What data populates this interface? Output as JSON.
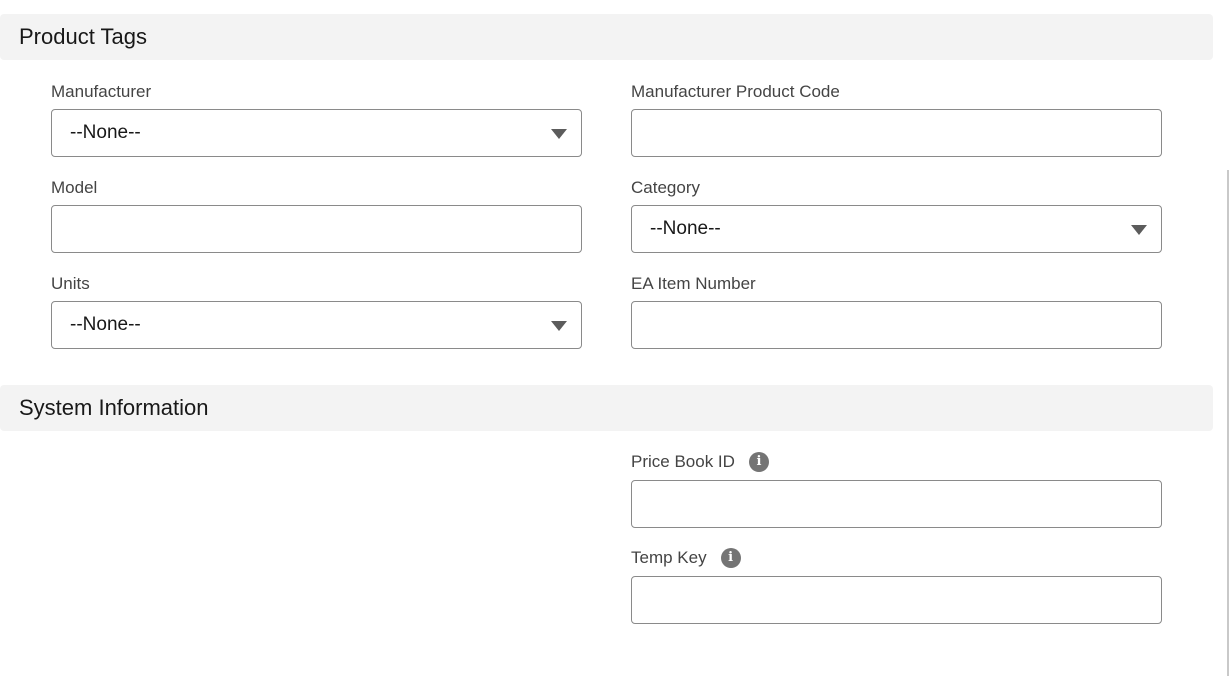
{
  "sections": {
    "product_tags": {
      "title": "Product Tags",
      "fields": {
        "manufacturer": {
          "label": "Manufacturer",
          "value": "--None--"
        },
        "manufacturer_product_code": {
          "label": "Manufacturer Product Code",
          "value": ""
        },
        "model": {
          "label": "Model",
          "value": ""
        },
        "category": {
          "label": "Category",
          "value": "--None--"
        },
        "units": {
          "label": "Units",
          "value": "--None--"
        },
        "ea_item_number": {
          "label": "EA Item Number",
          "value": ""
        }
      }
    },
    "system_information": {
      "title": "System Information",
      "fields": {
        "price_book_id": {
          "label": "Price Book ID",
          "value": "",
          "help_icon": "info-icon"
        },
        "temp_key": {
          "label": "Temp Key",
          "value": "",
          "help_icon": "info-icon"
        }
      }
    }
  },
  "icons": {
    "info_glyph": "i",
    "dropdown": "chevron-down-icon"
  },
  "colors": {
    "section_header_bg": "#f3f3f3",
    "input_border": "#8a8a8a",
    "info_icon": "#747474"
  }
}
